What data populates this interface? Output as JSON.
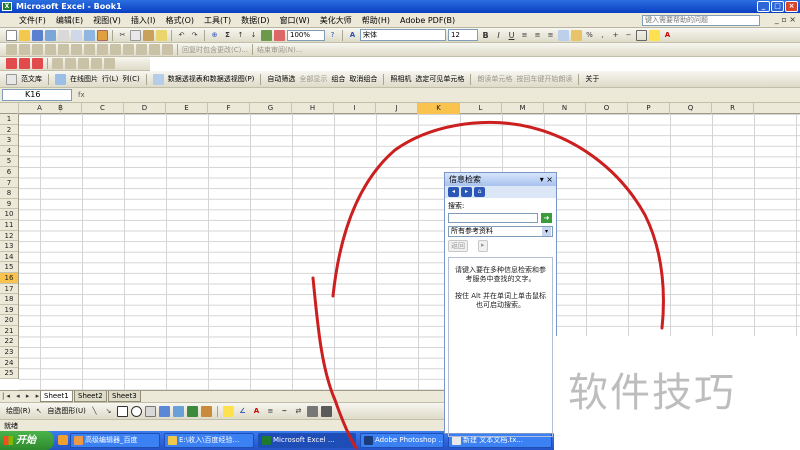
{
  "window": {
    "title": "Microsoft Excel - Book1"
  },
  "menu": {
    "items": [
      "文件(F)",
      "编辑(E)",
      "视图(V)",
      "插入(I)",
      "格式(O)",
      "工具(T)",
      "数据(D)",
      "窗口(W)",
      "美化大师",
      "帮助(H)",
      "Adobe PDF(B)"
    ],
    "help_placeholder": "键入需要帮助的问题"
  },
  "toolbar1": {
    "zoom": "100%",
    "font": "宋体",
    "size": "12",
    "bold": "B",
    "italic": "I",
    "underline": "U",
    "percent": "%",
    "comma": ","
  },
  "toolbar2": {
    "reply": "回复时包含更改(C)...",
    "end_review": "结束审阅(N)..."
  },
  "toolbar4": {
    "items": [
      "范文库",
      "在线图片",
      "行(L)",
      "列(C)",
      "数据透视表和数据透视图(P)",
      "自动筛选",
      "全部显示",
      "组合",
      "取消组合",
      "照相机",
      "选定可见单元格",
      "朗读单元格",
      "按回车键开始朗读",
      "关于"
    ]
  },
  "formula": {
    "name_box": "K16",
    "fx": "fx"
  },
  "grid": {
    "columns": [
      "A",
      "B",
      "C",
      "D",
      "E",
      "F",
      "G",
      "H",
      "I",
      "J",
      "K",
      "L",
      "M",
      "N",
      "O",
      "P",
      "Q",
      "R"
    ],
    "rows": [
      "1",
      "2",
      "3",
      "4",
      "5",
      "6",
      "7",
      "8",
      "9",
      "10",
      "11",
      "12",
      "13",
      "14",
      "15",
      "16",
      "17",
      "18",
      "19",
      "20",
      "21",
      "22",
      "23",
      "24",
      "25"
    ],
    "active_column": "K",
    "active_row": "16"
  },
  "sheets": {
    "tabs": [
      "Sheet1",
      "Sheet2",
      "Sheet3"
    ],
    "active": "Sheet1"
  },
  "drawing_toolbar": {
    "draw": "绘图(R)",
    "autoshapes": "自选图形(U)"
  },
  "status": {
    "text": "就绪"
  },
  "taskbar": {
    "start": "开始",
    "tasks": [
      "高级编辑器_百度",
      "E:\\收入\\百度经验...",
      "Microsoft Excel ...",
      "Adobe Photoshop ...",
      "新建 文本文档.tx..."
    ]
  },
  "research_pane": {
    "title": "信息检索",
    "search_label": "搜索:",
    "source": "所有参考资料",
    "back": "返回",
    "message1": "请键入要在多种信息检索和参考服务中查找的文字。",
    "message2": "按住 Alt 并在单词上单击鼠标也可启动搜索。"
  },
  "watermark": "软件技巧",
  "colors": {
    "title": "#0a3fc2",
    "active_header": "#f9c34d",
    "annotation": "#cc1f1f"
  }
}
